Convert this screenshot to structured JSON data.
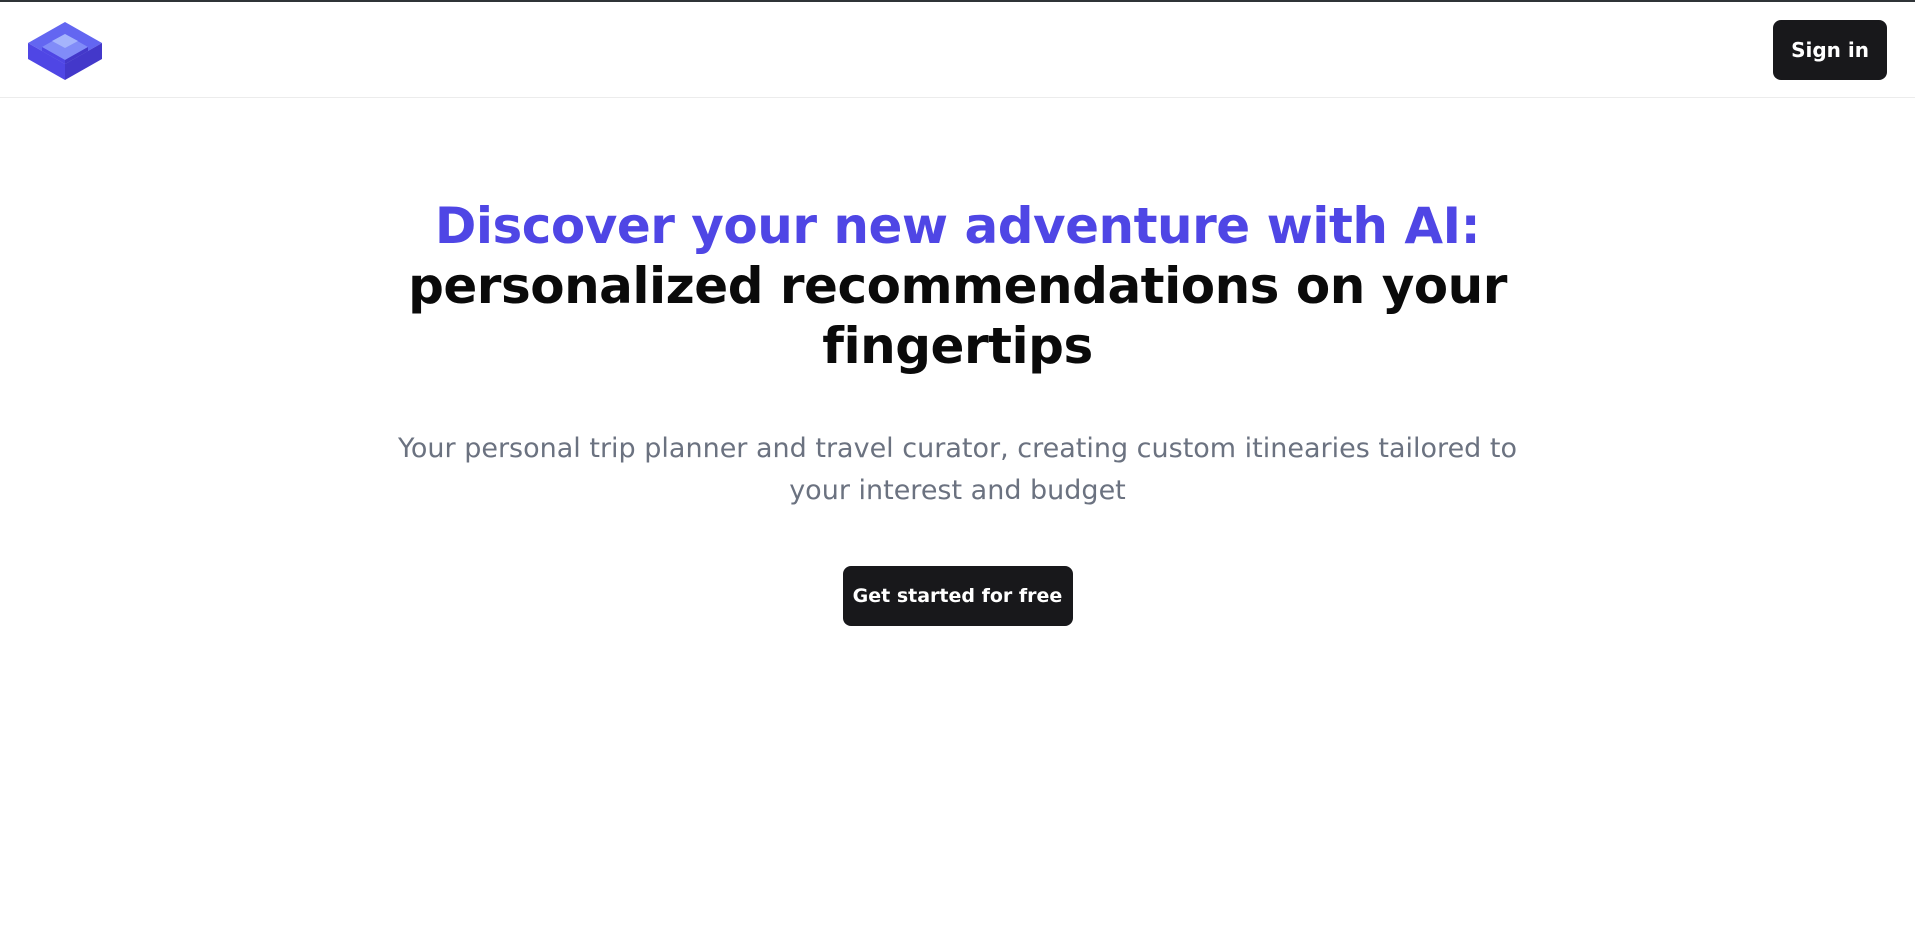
{
  "navbar": {
    "logo_icon": "stacked-layers-icon",
    "signin_label": "Sign in"
  },
  "hero": {
    "headline_accent": "Discover your new adventure with AI:",
    "headline_rest": "personalized recommendations on your fingertips",
    "subtitle": "Your personal trip planner and travel curator, creating custom itinearies tailored to your interest and budget",
    "cta_label": "Get started for free"
  },
  "colors": {
    "accent": "#4f46e5",
    "button_bg": "#18181b",
    "subtitle_text": "#6b7280"
  }
}
